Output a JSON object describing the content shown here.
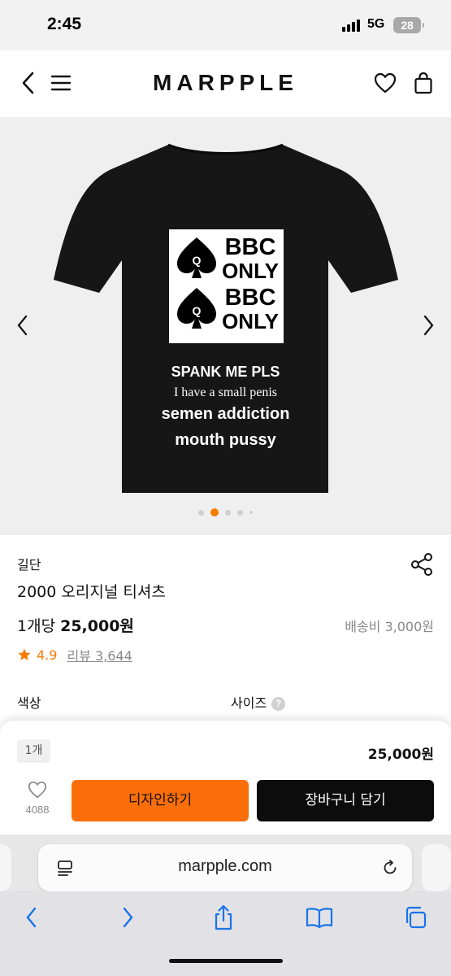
{
  "status_bar": {
    "time": "2:45",
    "network": "5G",
    "battery": "28"
  },
  "header": {
    "logo": "MARPPLE",
    "back_icon": "chevron-left-icon",
    "menu_icon": "hamburger-icon",
    "like_icon": "heart-outline-icon",
    "bag_icon": "bag-icon"
  },
  "hero": {
    "card_rows": [
      "BBC",
      "ONLY",
      "BBC",
      "ONLY"
    ],
    "card_symbol": "Q",
    "lines": [
      "SPANK ME PLS",
      "I have a small penis",
      "semen addiction",
      "mouth pussy"
    ],
    "slide_count": 5,
    "active_slide": 2
  },
  "product": {
    "brand": "길단",
    "name": "2000 오리지널 티셔츠",
    "unit_prefix": "1개당",
    "price": "25,000원",
    "shipping": "배송비 3,000원",
    "rating": "4.9",
    "review_label": "리뷰 3,644"
  },
  "options": {
    "color_label": "색상",
    "size_label": "사이즈",
    "help_symbol": "?"
  },
  "purchase": {
    "quantity": "1개",
    "total": "25,000원",
    "like_count": "4088",
    "design_button": "디자인하기",
    "cart_button": "장바구니 담기"
  },
  "browser": {
    "url": "marpple.com"
  },
  "colors": {
    "accent": "#fb6e0a",
    "star": "#f57c00",
    "dark": "#0c0c0c"
  }
}
